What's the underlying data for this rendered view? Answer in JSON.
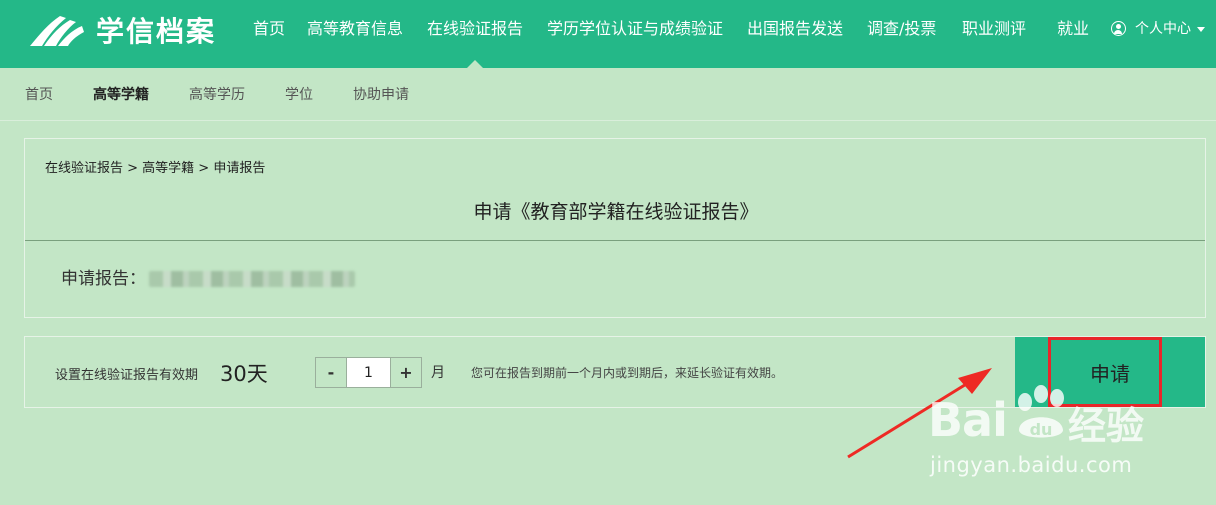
{
  "header": {
    "brand": "学信档案",
    "nav": [
      "首页",
      "高等教育信息",
      "在线验证报告",
      "学历学位认证与成绩验证",
      "出国报告发送",
      "调查/投票",
      "职业测评",
      "就业"
    ],
    "active_nav": "在线验证报告",
    "user_menu": "个人中心"
  },
  "subnav": {
    "items": [
      "首页",
      "高等学籍",
      "高等学历",
      "学位",
      "协助申请"
    ],
    "active": "高等学籍"
  },
  "report": {
    "breadcrumb": "在线验证报告 > 高等学籍 > 申请报告",
    "title": "申请《教育部学籍在线验证报告》",
    "apply_label": "申请报告："
  },
  "validity": {
    "label": "设置在线验证报告有效期",
    "days": "30天",
    "decrement": "-",
    "months": "1",
    "increment": "+",
    "unit": "月",
    "hint": "您可在报告到期前一个月内或到期后，来延长验证有效期。",
    "apply_button": "申请"
  },
  "watermark": {
    "logo": "Bai",
    "logo_tail": "du",
    "brand": "经验",
    "url": "jingyan.baidu.com"
  },
  "colors": {
    "header": "#24b888",
    "page_bg": "#c3e6c6",
    "highlight": "#e8262a"
  }
}
